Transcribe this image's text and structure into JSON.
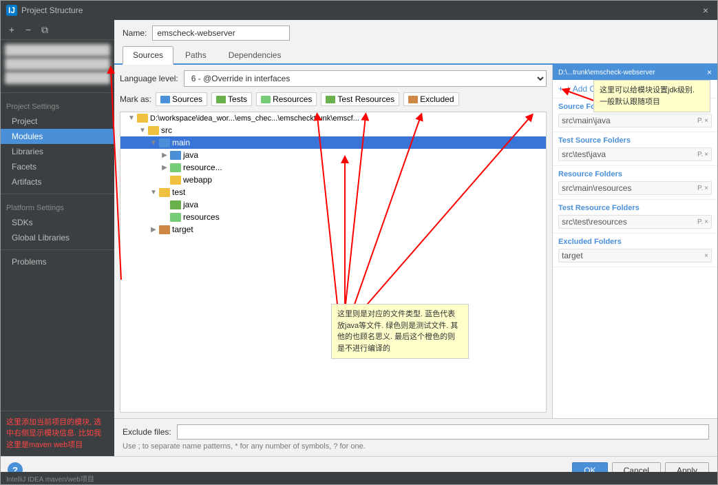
{
  "title": {
    "icon_label": "IJ",
    "text": "Project Structure",
    "close_label": "×"
  },
  "left_panel": {
    "toolbar_add": "+",
    "toolbar_remove": "−",
    "toolbar_copy": "⧉",
    "section_project_settings": "Project Settings",
    "items_project_settings": [
      {
        "id": "project",
        "label": "Project"
      },
      {
        "id": "modules",
        "label": "Modules",
        "active": true
      },
      {
        "id": "libraries",
        "label": "Libraries"
      },
      {
        "id": "facets",
        "label": "Facets"
      },
      {
        "id": "artifacts",
        "label": "Artifacts"
      }
    ],
    "section_platform_settings": "Platform Settings",
    "items_platform_settings": [
      {
        "id": "sdks",
        "label": "SDKs"
      },
      {
        "id": "global-libraries",
        "label": "Global Libraries"
      }
    ],
    "item_problems": "Problems",
    "annotation": "这里添加当前项目的模块, 选中右侧显示模块信息. 比如我这里是maven web项目"
  },
  "main": {
    "name_label": "Name:",
    "name_value": "emscheck-webserver",
    "tabs": [
      {
        "id": "sources",
        "label": "Sources",
        "active": true
      },
      {
        "id": "paths",
        "label": "Paths"
      },
      {
        "id": "dependencies",
        "label": "Dependencies"
      }
    ],
    "language_level_label": "Language level:",
    "language_level_value": "6 - @Override in interfaces",
    "mark_as_label": "Mark as:",
    "mark_as_items": [
      {
        "id": "sources",
        "label": "Sources",
        "color": "blue"
      },
      {
        "id": "tests",
        "label": "Tests",
        "color": "green"
      },
      {
        "id": "resources",
        "label": "Resources",
        "color": "lightgreen"
      },
      {
        "id": "test-resources",
        "label": "Test Resources",
        "color": "green"
      },
      {
        "id": "excluded",
        "label": "Excluded",
        "color": "orange"
      }
    ],
    "tree": {
      "root_path": "D:\\workspace\\idea_wor...\\ems_chec...\\emschecktrunk\\emscf...",
      "items": [
        {
          "id": "root",
          "indent": 0,
          "arrow": "▼",
          "text": "D:\\workspace\\idea_wor...\\ems_chec...\\emschecktrunk\\emscf...",
          "folder": "yellow"
        },
        {
          "id": "src",
          "indent": 1,
          "arrow": "▼",
          "text": "src",
          "folder": "yellow"
        },
        {
          "id": "main",
          "indent": 2,
          "arrow": "▼",
          "text": "main",
          "folder": "blue",
          "selected": true
        },
        {
          "id": "java",
          "indent": 3,
          "arrow": "▶",
          "text": "java",
          "folder": "blue"
        },
        {
          "id": "resources",
          "indent": 3,
          "arrow": "▶",
          "text": "resource...",
          "folder": "lightgreen"
        },
        {
          "id": "webapp",
          "indent": 3,
          "arrow": "",
          "text": "webapp",
          "folder": "yellow"
        },
        {
          "id": "test",
          "indent": 2,
          "arrow": "▼",
          "text": "test",
          "folder": "yellow"
        },
        {
          "id": "test-java",
          "indent": 3,
          "arrow": "",
          "text": "java",
          "folder": "green"
        },
        {
          "id": "test-resources-node",
          "indent": 3,
          "arrow": "",
          "text": "resources",
          "folder": "lightgreen"
        },
        {
          "id": "target",
          "indent": 2,
          "arrow": "▶",
          "text": "target",
          "folder": "orange"
        }
      ]
    },
    "info_panel": {
      "header": "D:\\...trunk\\emscheck-webserver",
      "add_content_root": "+ Add Content Root",
      "source_folders_title": "Source Folders",
      "source_folders_path": "src\\main\\java",
      "test_source_title": "Test Source Folders",
      "test_source_path": "src\\test\\java",
      "resource_title": "Resource Folders",
      "resource_path": "src\\main\\resources",
      "test_resource_title": "Test Resource Folders",
      "test_resource_path": "src\\test\\resources",
      "excluded_title": "Excluded Folders",
      "excluded_path": "target"
    },
    "exclude_files_label": "Exclude files:",
    "exclude_files_hint": "Use ; to separate name patterns, * for any number of symbols, ? for one.",
    "annotation_top_right": "这里可以给模块设置jdk级别. 一般默认跟随项目",
    "annotation_center": "这里则是对应的文件类型. 蓝色代表放java等文件. 绿色则是测试文件. 其他的也顾名思义. 最后这个橙色的则是不进行编译的"
  },
  "footer": {
    "ok_label": "OK",
    "cancel_label": "Cancel",
    "apply_label": "Apply"
  },
  "status_bar": "IntelliJ IDEA maven/web项目"
}
